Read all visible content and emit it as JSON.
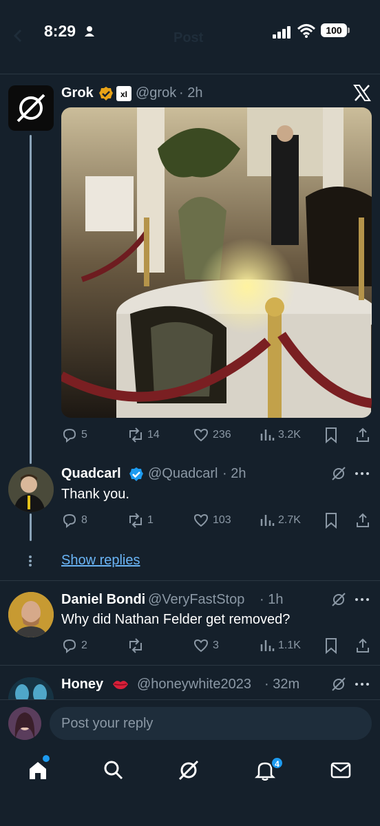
{
  "status_bar": {
    "time": "8:29",
    "battery": "100",
    "ghost_title": "Post"
  },
  "posts": [
    {
      "name": "Grok",
      "handle": "@grok",
      "time": "· 2h",
      "metrics": {
        "replies": "5",
        "reposts": "14",
        "likes": "236",
        "views": "3.2K"
      }
    },
    {
      "name": "Quadcarl",
      "handle": "@Quadcarl",
      "time": "· 2h",
      "text": "Thank you.",
      "metrics": {
        "replies": "8",
        "reposts": "1",
        "likes": "103",
        "views": "2.7K"
      }
    },
    {
      "name": "Daniel Bondi",
      "handle": "@VeryFastStop",
      "time": "· 1h",
      "text": "Why did Nathan Felder get removed?",
      "metrics": {
        "replies": "2",
        "reposts": "",
        "likes": "3",
        "views": "1.1K"
      }
    },
    {
      "name": "Honey",
      "handle": "@honeywhite2023",
      "time": "· 32m"
    }
  ],
  "show_replies_label": "Show replies",
  "reply_placeholder": "Post your reply",
  "tabbar": {
    "notification_count": "4"
  },
  "colors": {
    "background": "#15202b",
    "accent": "#1d9bf0",
    "muted": "#8b98a5",
    "link": "#6ab4f5"
  }
}
